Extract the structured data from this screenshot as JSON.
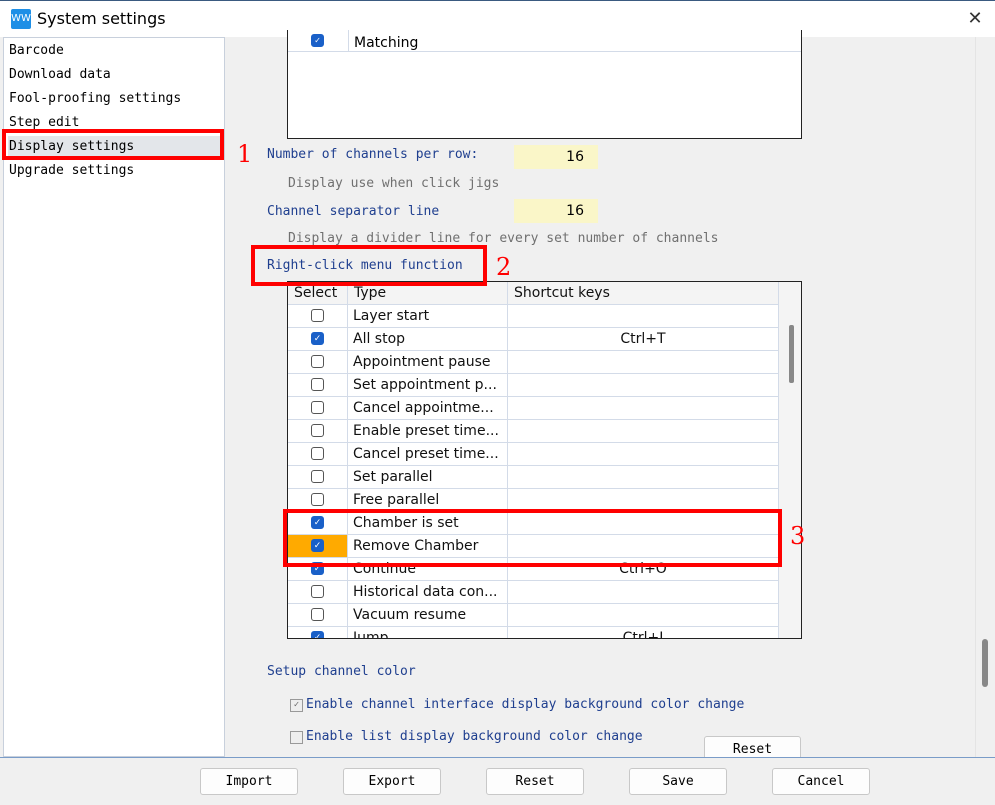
{
  "window": {
    "title": "System settings",
    "icon": "app-waveform-icon",
    "close_icon": "close-icon",
    "close_glyph": "✕"
  },
  "sidebar": {
    "items": [
      {
        "label": "Barcode"
      },
      {
        "label": "Download data"
      },
      {
        "label": "Fool-proofing settings"
      },
      {
        "label": "Step edit"
      },
      {
        "label": "Display settings",
        "selected": true
      },
      {
        "label": "Upgrade settings"
      }
    ]
  },
  "top_list": {
    "rows": [
      {
        "type": "Matching",
        "checked": true
      }
    ]
  },
  "channels_per_row": {
    "label": "Number of channels per row:",
    "value": "16",
    "hint": "Display use when click jigs"
  },
  "separator": {
    "label": "Channel separator line",
    "value": "16",
    "hint": "Display a divider line for every set number of channels"
  },
  "right_click": {
    "label": "Right-click menu function",
    "headers": [
      "Select",
      "Type",
      "Shortcut keys"
    ],
    "rows": [
      {
        "type": "Layer start",
        "checked": false,
        "shortcut": ""
      },
      {
        "type": "All stop",
        "checked": true,
        "shortcut": "Ctrl+T"
      },
      {
        "type": "Appointment pause",
        "checked": false,
        "shortcut": ""
      },
      {
        "type": "Set appointment p...",
        "checked": false,
        "shortcut": ""
      },
      {
        "type": "Cancel appointme...",
        "checked": false,
        "shortcut": ""
      },
      {
        "type": "Enable preset time...",
        "checked": false,
        "shortcut": ""
      },
      {
        "type": "Cancel preset time...",
        "checked": false,
        "shortcut": ""
      },
      {
        "type": "Set parallel",
        "checked": false,
        "shortcut": ""
      },
      {
        "type": "Free parallel",
        "checked": false,
        "shortcut": ""
      },
      {
        "type": "Chamber is set",
        "checked": true,
        "shortcut": ""
      },
      {
        "type": "Remove Chamber",
        "checked": true,
        "shortcut": "",
        "highlight": "#ffaa00"
      },
      {
        "type": "Continue",
        "checked": true,
        "shortcut": "Ctrl+O"
      },
      {
        "type": "Historical data con...",
        "checked": false,
        "shortcut": ""
      },
      {
        "type": "Vacuum resume",
        "checked": false,
        "shortcut": ""
      },
      {
        "type": "Jump",
        "checked": true,
        "shortcut": "Ctrl+J"
      }
    ]
  },
  "channel_color": {
    "label": "Setup channel color",
    "options": [
      {
        "label": "Enable channel interface display background color change",
        "checked": true
      },
      {
        "label": "Enable list display background color change",
        "checked": false
      }
    ],
    "reset_label": "Reset"
  },
  "annotations": [
    "1",
    "2",
    "3"
  ],
  "footer": {
    "buttons": [
      "Import",
      "Export",
      "Reset",
      "Save",
      "Cancel"
    ]
  },
  "colors": {
    "annotation": "#ff0000",
    "label_blue": "#1f3f8f",
    "input_bg": "#faf6c8",
    "checkbox": "#1a60c8",
    "highlight": "#ffaa00"
  }
}
